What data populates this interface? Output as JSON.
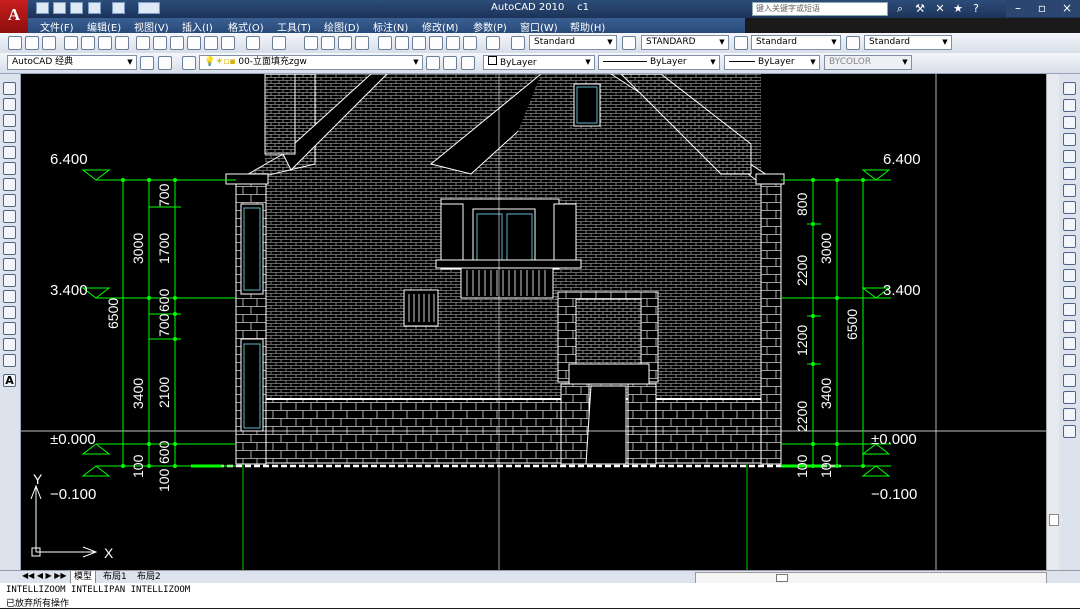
{
  "app": {
    "title": "AutoCAD 2010",
    "doc": "c1",
    "logo": "A",
    "search_placeholder": "键入关键字或短语"
  },
  "menu": [
    "文件(F)",
    "编辑(E)",
    "视图(V)",
    "插入(I)",
    "格式(O)",
    "工具(T)",
    "绘图(D)",
    "标注(N)",
    "修改(M)",
    "参数(P)",
    "窗口(W)",
    "帮助(H)"
  ],
  "toolbar1": {
    "text_style": "Standard",
    "dim_style": "STANDARD",
    "table_style": "Standard",
    "mleader_style": "Standard"
  },
  "toolbar2": {
    "workspace": "AutoCAD 经典",
    "layer": "00-立面填充zgw",
    "color": "ByLayer",
    "linetype": "ByLayer",
    "lineweight": "ByLayer",
    "plotstyle": "BYCOLOR"
  },
  "colors": {
    "bg": "#000000",
    "lines": "#ffffff",
    "dims": "#00ff00",
    "accent": "#c81e1e",
    "glass": "#5fb5c8"
  },
  "drawing": {
    "levels_left": [
      "6.400",
      "3.400",
      "±0.000",
      "−0.100"
    ],
    "levels_right": [
      "6.400",
      "3.400",
      "±0.000",
      "−0.100"
    ],
    "dims_left_outer": [
      "6500"
    ],
    "dims_left_mid": [
      "3000",
      "3400",
      "100"
    ],
    "dims_left_inner": [
      "700",
      "1700",
      "600",
      "700",
      "2100",
      "600",
      "100"
    ],
    "dims_right_inner": [
      "800",
      "2200",
      "1200",
      "2200",
      "100"
    ],
    "dims_right_mid": [
      "3000",
      "3400",
      "100"
    ],
    "dims_right_outer": [
      "6500"
    ],
    "ucs_x": "X",
    "ucs_y": "Y"
  },
  "tabs": [
    "模型",
    "布局1",
    "布局2"
  ],
  "command": {
    "line1": "INTELLIZOOM  INTELLIPAN  INTELLIZOOM",
    "line2": "已放弃所有操作"
  }
}
